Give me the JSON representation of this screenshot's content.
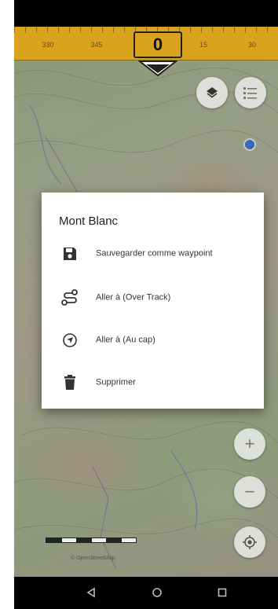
{
  "compass": {
    "tick_labels": [
      "330",
      "345",
      "15",
      "30"
    ],
    "heading": "0",
    "strip_color": "#d9a31e"
  },
  "map_controls": [
    {
      "name": "layers-icon"
    },
    {
      "name": "list-icon"
    },
    {
      "name": "zoom-in",
      "glyph": "+"
    },
    {
      "name": "zoom-out",
      "glyph": "−"
    },
    {
      "name": "my-location-icon"
    }
  ],
  "dialog": {
    "title": "Mont Blanc",
    "items": [
      {
        "icon": "save-icon",
        "label": "Sauvegarder comme waypoint"
      },
      {
        "icon": "route-icon",
        "label": "Aller à (Over Track)"
      },
      {
        "icon": "navigation-icon",
        "label": "Aller à (Au cap)"
      },
      {
        "icon": "trash-icon",
        "label": "Supprimer"
      }
    ]
  },
  "map": {
    "attribution": "© OpenStreetMap"
  },
  "navigation_bar": {
    "buttons": [
      "back-icon",
      "home-icon",
      "recents-icon"
    ]
  },
  "colors": {
    "dialog_bg": "#ffffff",
    "accent_blue": "#2f7be5",
    "icon_dark": "#333333"
  }
}
